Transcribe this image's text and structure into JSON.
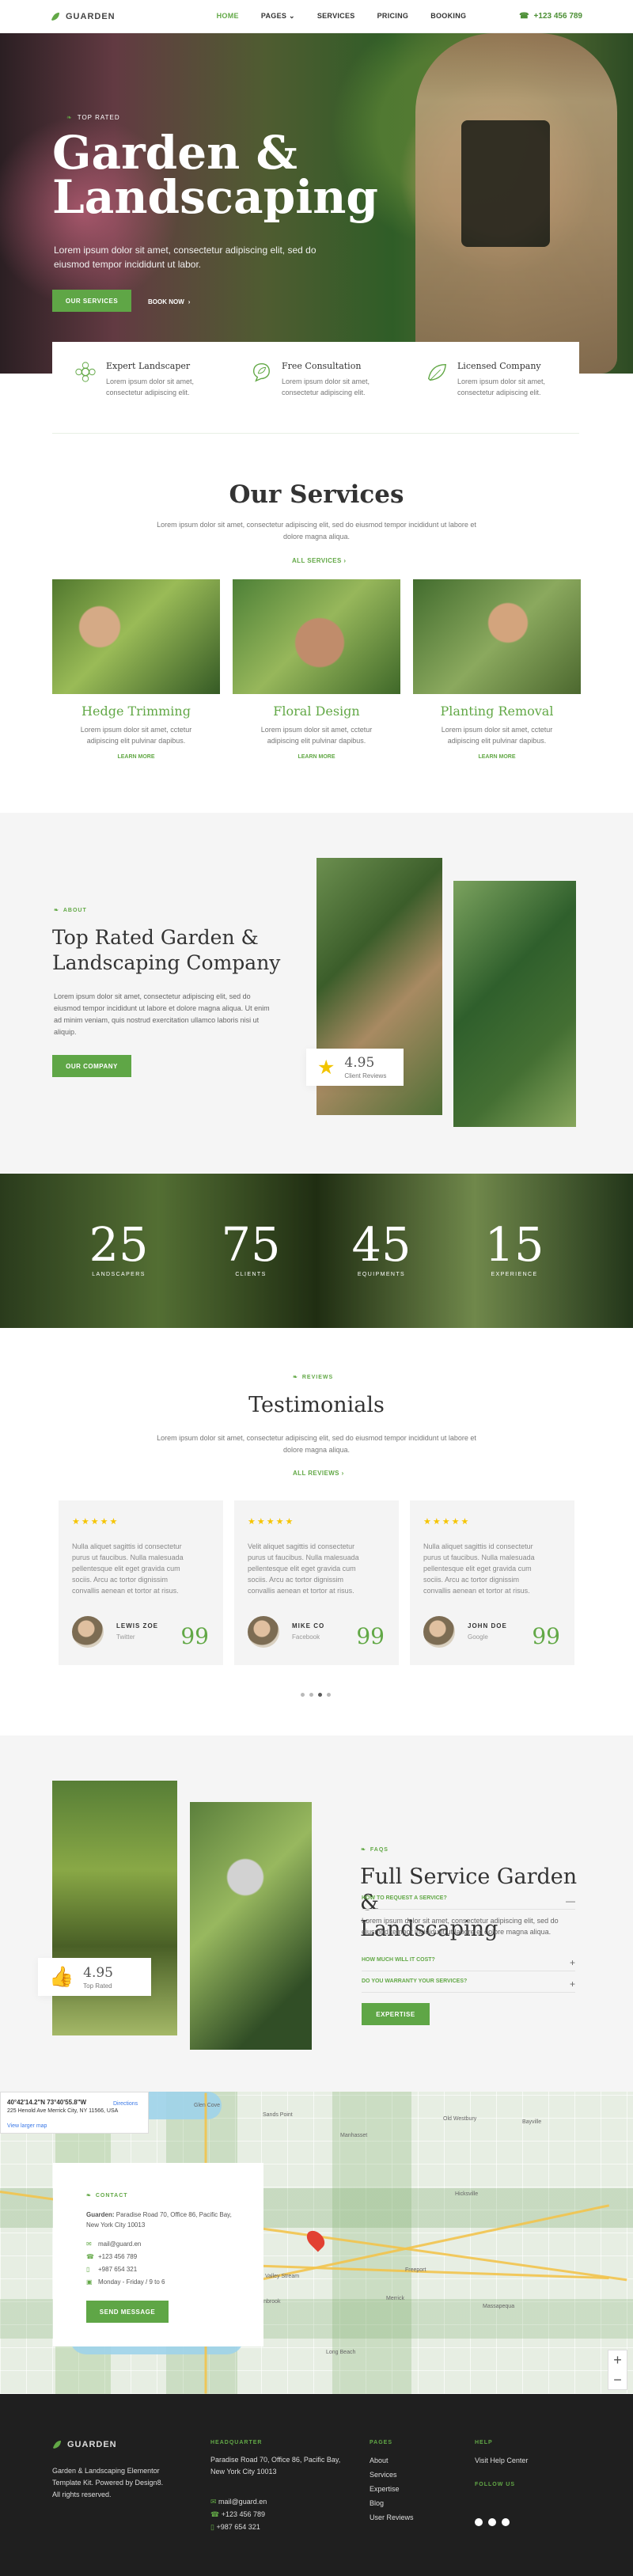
{
  "nav": {
    "brand": "GUARDEN",
    "items": [
      {
        "label": "HOME"
      },
      {
        "label": "PAGES"
      },
      {
        "label": "SERVICES"
      },
      {
        "label": "PRICING"
      },
      {
        "label": "BOOKING"
      }
    ],
    "phone": "+123 456 789"
  },
  "hero": {
    "subtitle": "TOP RATED",
    "title_line1": "Garden &",
    "title_line2": "Landscaping",
    "text": "Lorem ipsum dolor sit amet, consectetur adipiscing elit, sed do eiusmod tempor incididunt ut labor.",
    "primary_button": "OUR SERVICES",
    "secondary_button": "BOOK NOW"
  },
  "features": [
    {
      "title": "Expert Landscaper",
      "text": "Lorem ipsum dolor sit amet, consectetur adipiscing elit."
    },
    {
      "title": "Free Consultation",
      "text": "Lorem ipsum dolor sit amet, consectetur adipiscing elit."
    },
    {
      "title": "Licensed Company",
      "text": "Lorem ipsum dolor sit amet, consectetur adipiscing elit."
    }
  ],
  "services": {
    "title": "Our Services",
    "text": "Lorem ipsum dolor sit amet, consectetur adipiscing elit, sed do eiusmod tempor incididunt ut labore et dolore magna aliqua.",
    "link": "ALL SERVICES",
    "items": [
      {
        "title": "Hedge Trimming",
        "text": "Lorem ipsum dolor sit amet, cctetur adipiscing elit pulvinar dapibus.",
        "link": "LEARN MORE"
      },
      {
        "title": "Floral Design",
        "text": "Lorem ipsum dolor sit amet, cctetur adipiscing elit pulvinar dapibus.",
        "link": "LEARN MORE"
      },
      {
        "title": "Planting Removal",
        "text": "Lorem ipsum dolor sit amet, cctetur adipiscing elit pulvinar dapibus.",
        "link": "LEARN MORE"
      }
    ]
  },
  "about": {
    "kicker": "ABOUT",
    "title_line1": "Top Rated Garden &",
    "title_line2": "Landscaping Company",
    "text": "Lorem ipsum dolor sit amet, consectetur adipiscing elit, sed do eiusmod tempor incididunt ut labore et dolore magna aliqua. Ut enim ad minim veniam, quis nostrud exercitation ullamco laboris nisi ut aliquip.",
    "button": "OUR COMPANY",
    "rating": {
      "value": "4.95",
      "label": "Client Reviews"
    }
  },
  "stats": [
    {
      "value": "25",
      "label": "LANDSCAPERS"
    },
    {
      "value": "75",
      "label": "CLIENTS"
    },
    {
      "value": "45",
      "label": "EQUIPMENTS"
    },
    {
      "value": "15",
      "label": "EXPERIENCE"
    }
  ],
  "testimonials": {
    "kicker": "REVIEWS",
    "title": "Testimonials",
    "text": "Lorem ipsum dolor sit amet, consectetur adipiscing elit, sed do eiusmod tempor incididunt ut labore et dolore magna aliqua.",
    "link": "ALL REVIEWS",
    "items": [
      {
        "stars": "★★★★★",
        "text": "Nulla aliquet sagittis id consectetur purus ut faucibus. Nulla malesuada pellentesque elit eget gravida cum sociis. Arcu ac tortor dignissim convallis aenean et tortor at risus.",
        "name": "LEWIS ZOE",
        "role": "Twitter"
      },
      {
        "stars": "★★★★★",
        "text": "Velit aliquet sagittis id consectetur purus ut faucibus. Nulla malesuada pellentesque elit eget gravida cum sociis. Arcu ac tortor dignissim convallis aenean et tortor at risus.",
        "name": "MIKE CO",
        "role": "Facebook"
      },
      {
        "stars": "★★★★★",
        "text": "Nulla aliquet sagittis id consectetur purus ut faucibus. Nulla malesuada pellentesque elit eget gravida cum sociis. Arcu ac tortor dignissim convallis aenean et tortor at risus.",
        "name": "JOHN DOE",
        "role": "Google"
      }
    ]
  },
  "faq": {
    "kicker": "FAQS",
    "title_line1": "Full Service Garden &",
    "title_line2": "Landscaping",
    "questions": [
      {
        "label": "HOW TO REQUEST A SERVICE?",
        "sign": "—"
      },
      {
        "label": "HOW MUCH WILL IT COST?",
        "sign": "+"
      },
      {
        "label": "DO YOU WARRANTY YOUR SERVICES?",
        "sign": "+"
      }
    ],
    "answer": "Lorem ipsum dolor sit amet, consectetur adipiscing elit, sed do eiusmod tempor incididunt ut labore et dolore magna aliqua.",
    "button": "EXPERTISE",
    "rating": {
      "value": "4.95",
      "label": "Top Rated"
    }
  },
  "map": {
    "coords": "40°42'14.2\"N 73°40'55.8\"W",
    "address": "225 Henold Ave Merrick City, NY 11566, USA",
    "directions": "Directions",
    "larger": "View larger map",
    "places": [
      "Glen Cove",
      "Sands Point",
      "Manhasset",
      "Old Westbury",
      "Valley Stream",
      "Long Beach",
      "Massapequa",
      "Merrick",
      "Lynbrook",
      "Hicksville",
      "Freeport",
      "Bayville"
    ]
  },
  "contact": {
    "kicker": "CONTACT",
    "company": "Guarden:",
    "address": "Paradise Road 70, Office 86, Pacific Bay, New York City 10013",
    "email": "mail@guard.en",
    "phone1": "+123 456 789",
    "phone2": "+987 654 321",
    "hours": "Monday - Friday / 9 to 6",
    "button": "SEND MESSAGE"
  },
  "footer": {
    "brand": "GUARDEN",
    "description": "Garden & Landscaping Elementor Template Kit. Powered by Design8. All rights reserved.",
    "hq_title": "HEADQUARTER",
    "hq_address": "Paradise Road 70, Office 86, Pacific Bay, New York City 10013",
    "email": "mail@guard.en",
    "phone1": "+123 456 789",
    "phone2": "+987 654 321",
    "pages_title": "PAGES",
    "pages": [
      "About",
      "Services",
      "Expertise",
      "Blog",
      "User Reviews"
    ],
    "help_title": "HELP",
    "help_link": "Visit Help Center",
    "follow_title": "FOLLOW US"
  },
  "colors": {
    "accent": "#62a846",
    "dark": "#1f1f1f",
    "light_bg": "#f5f5f5"
  }
}
